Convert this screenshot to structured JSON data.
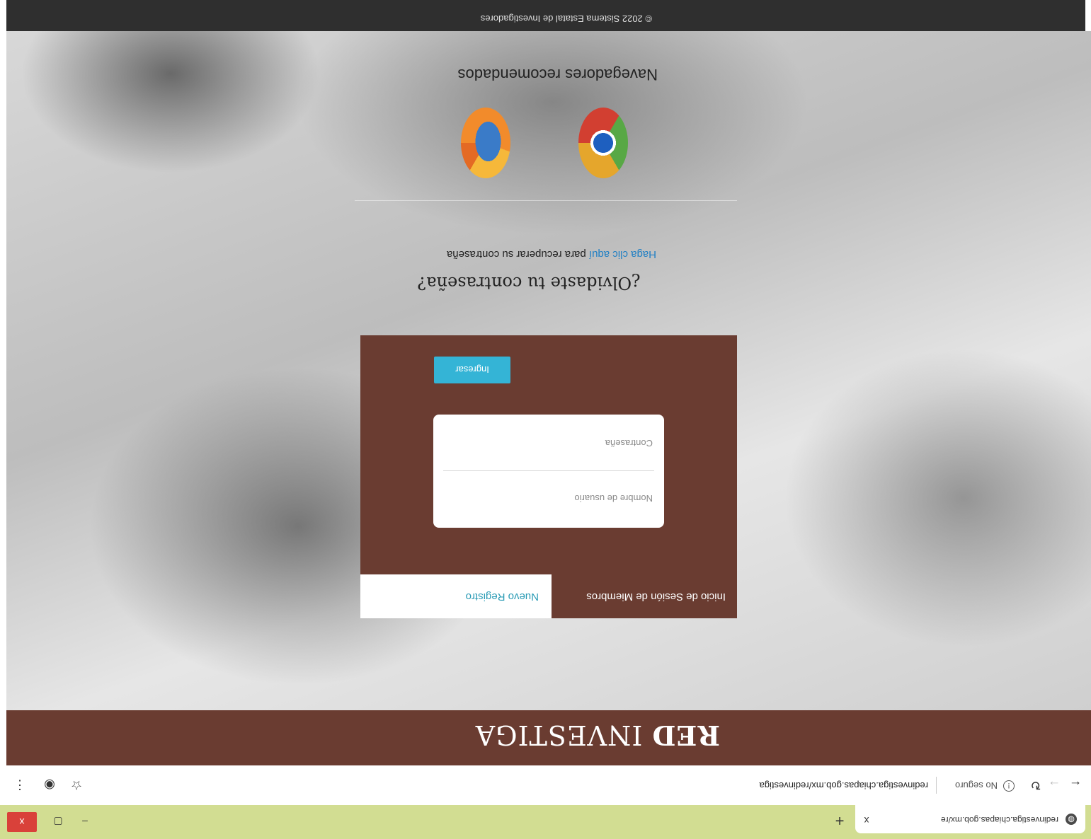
{
  "browser": {
    "tab_title": "redinvestiga.chiapas.gob.mx/re",
    "tab_close": "x",
    "new_tab": "+",
    "security_label": "No seguro",
    "url": "redinvestiga.chiapas.gob.mx/redinvestiga",
    "window_close": "x",
    "window_restore": "▢",
    "window_minimize": "–"
  },
  "header": {
    "brand_bold": "RED",
    "brand_light": "INVESTIGA"
  },
  "login": {
    "tab_login": "Inicio de Sesión de Miembros",
    "tab_register": "Nuevo Registro",
    "username_placeholder": "Nombre de usuario",
    "password_placeholder": "Contraseña",
    "submit_label": "Ingresar"
  },
  "forgot": {
    "title": "¿Olvidaste tu contraseña?",
    "link_text": "Haga clic aquí",
    "rest_text": "para recuperar su contraseña"
  },
  "browsers_note": "Navegadores recomendados",
  "footer": {
    "text": "© 2022 Sistema Estatal de Investigadores"
  },
  "icons": [
    "globe-icon",
    "close-icon",
    "plus-icon",
    "back-arrow-icon",
    "forward-arrow-icon",
    "reload-icon",
    "info-icon",
    "star-icon",
    "profile-icon",
    "menu-dots-icon",
    "chrome-logo-icon",
    "firefox-logo-icon"
  ]
}
